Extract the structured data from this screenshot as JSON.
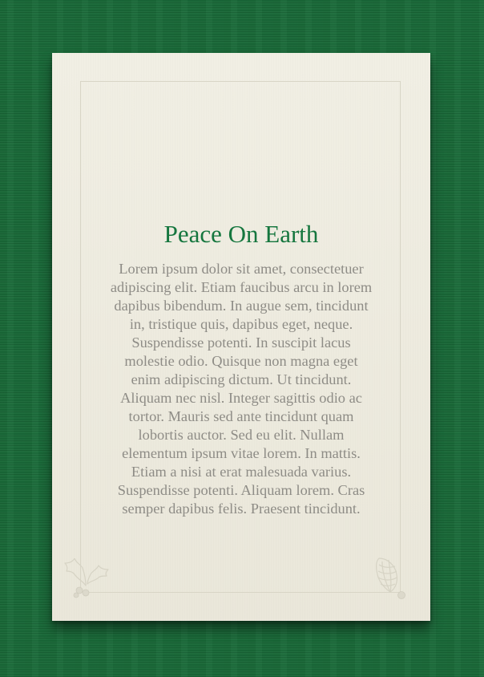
{
  "card": {
    "title": "Peace On Earth",
    "body": "Lorem ipsum dolor sit amet, consectetuer adipiscing elit. Etiam faucibus arcu in lorem dapibus bibendum. In augue sem, tincidunt in, tristique quis, dapibus eget, neque. Suspendisse potenti. In suscipit lacus molestie odio. Quisque non magna eget enim adipiscing dictum. Ut tincidunt. Aliquam nec nisl. Integer sagittis odio ac tortor. Mauris sed ante tincidunt quam lobortis auctor. Sed eu elit. Nullam elementum ipsum vitae lorem. In mattis. Etiam a nisi at erat malesuada varius. Suspendisse potenti. Aliquam lorem. Cras semper dapibus felis. Praesent tincidunt."
  },
  "colors": {
    "background": "#1a6b39",
    "card": "#efede2",
    "title": "#15763e",
    "body_text": "#8e8c86",
    "frame_line": "#d8d5c6"
  },
  "icons": {
    "left_corner": "holly-icon",
    "right_corner": "pinecone-icon"
  }
}
